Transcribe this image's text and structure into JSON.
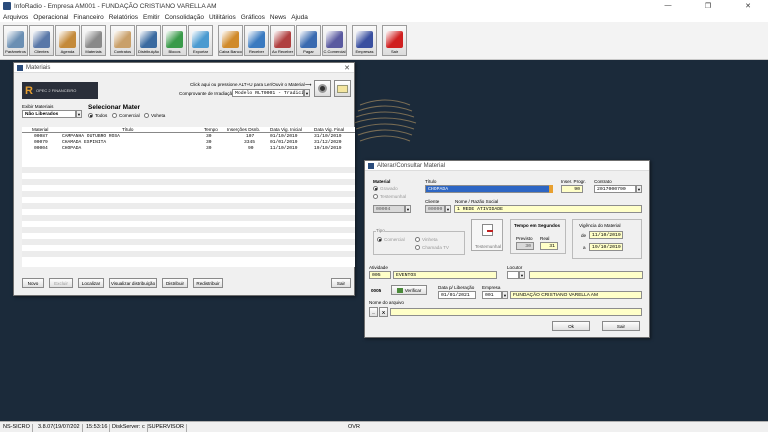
{
  "app": {
    "title": "InfoRadio - Empresa AM001 - FUNDAÇÃO CRISTIANO VARELLA AM"
  },
  "menu": [
    "Arquivos",
    "Operacional",
    "Financeiro",
    "Relatórios",
    "Emitir",
    "Consolidação",
    "Utilitários",
    "Gráficos",
    "News",
    "Ajuda"
  ],
  "toolbar": [
    {
      "label": "Parâmetros",
      "color": "#6b8fb3"
    },
    {
      "label": "Clientes",
      "color": "#5a78a8"
    },
    {
      "label": "Agenda",
      "color": "#c48a3a"
    },
    {
      "label": "Materiais",
      "color": "#8a8a8a"
    },
    {
      "label": "Contratos",
      "color": "#c9a06a"
    },
    {
      "label": "Distribuição",
      "color": "#3a6aa0"
    },
    {
      "label": "Blocos",
      "color": "#3a9a4a"
    },
    {
      "label": "Exportar",
      "color": "#4a9ad0"
    },
    {
      "label": "Caixa Banco",
      "color": "#d08a2a"
    },
    {
      "label": "Receber",
      "color": "#3a7ac0"
    },
    {
      "label": "Ao Receber",
      "color": "#b04040"
    },
    {
      "label": "Pagar",
      "color": "#3a6ab0"
    },
    {
      "label": "C.Comercial",
      "color": "#5a5aa0"
    },
    {
      "label": "Empresas",
      "color": "#3a50a0"
    },
    {
      "label": "Sair",
      "color": "#d02020"
    }
  ],
  "materiais": {
    "title": "Materiais",
    "logo_text": "OPEC 2 FINANCEIRO",
    "hint": "Click aqui ou pressione ALT+U para Ler/Ouvir o Material",
    "hint_arrow": "⟶",
    "comprovante_label": "Comprovante de Irradiação:",
    "comprovante_value": "Modelo RLT0001 - Tradicional",
    "exibir_label": "Exibir Materiais",
    "exibir_value": "Não Liberados",
    "selecionar_label": "Selecionar Mater",
    "radios": [
      {
        "label": "Todos",
        "selected": true
      },
      {
        "label": "Comercial",
        "selected": false
      },
      {
        "label": "Voheta",
        "selected": false
      }
    ],
    "columns": [
      "Material",
      "Título",
      "Tempo",
      "Inserções Dsnb.",
      "Data Vig. Inicial",
      "Data Vig. Final"
    ],
    "rows": [
      [
        "00087",
        "CAMPANHA OUTUBRO ROSA",
        "30",
        "107",
        "01/10/2019",
        "31/10/2019"
      ],
      [
        "00079",
        "CHAMADA ESPINITA",
        "30",
        "3345",
        "01/01/2019",
        "31/12/2020"
      ],
      [
        "00004",
        "CHOPADA",
        "30",
        "90",
        "11/10/2019",
        "19/10/2019"
      ]
    ],
    "buttons": {
      "novo": "Novo",
      "excluir": "Excluir",
      "localizar": "Localizar",
      "visualizar": "Visualizar distribuição",
      "distribuir": "Distribuir",
      "redistribuir": "Redistribuir",
      "sair": "Sair"
    }
  },
  "alterar": {
    "title": "Alterar/Consultar Material",
    "material_label": "Material",
    "radio_gravado": "Gravado",
    "radio_testemunhal": "Testemunhal",
    "material_code": "00004",
    "titulo_label": "Título",
    "titulo_value": "CHOPADA",
    "insercoes_label": "Inser. Progr.",
    "insercoes_value": "90",
    "contrato_label": "Contrato",
    "contrato_value": "2017000790",
    "cliente_label": "Cliente",
    "cliente_code": "00090",
    "nome_label": "Nome / Razão Social",
    "nome_value": "1 REDE ATIVIDADE",
    "tipo_label": "Tipo",
    "tipo_comercial": "Comercial",
    "tipo_vinheta": "Vinheta",
    "tipo_chamada": "Chamada TV",
    "testemunhal_label": "Testemunhal",
    "tempo_label": "Tempo em Segundos",
    "previsto_label": "Previsto",
    "previsto_value": "30",
    "real_label": "Real",
    "real_value": "31",
    "vigencia_label": "Vigência do Material",
    "de_label": "de",
    "de_value": "11/10/2019",
    "a_label": "a",
    "a_value": "19/10/2019",
    "atividade_label": "Atividade",
    "atividade_code": "005",
    "atividade_value": "EVENTOS",
    "locutor_label": "Locutor",
    "code_0005": "0005",
    "verificar_label": "Verificar",
    "data_lib_label": "Data p/ Liberação",
    "data_lib_value": "01/01/2021",
    "empresa_label": "Empresa",
    "empresa_code": "001",
    "empresa_value": "FUNDAÇÃO CRISTIANO VARELLA AM",
    "arquivo_label": "Nome do arquivo",
    "ok_label": "Ok",
    "sair_label": "Sair"
  },
  "status": [
    "NS-SICRO",
    "3.8.07(19/07/202",
    "15:53:16",
    "DiskServer: c",
    "SUPERVISOR",
    "OVR"
  ]
}
